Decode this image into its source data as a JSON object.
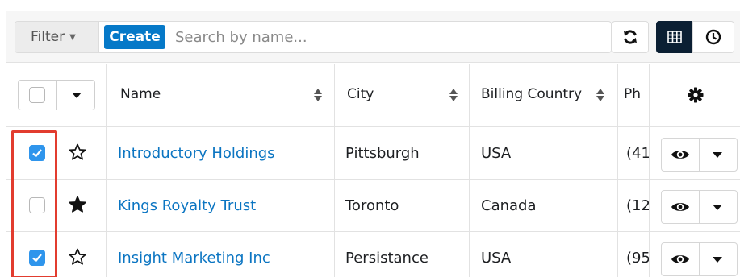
{
  "toolbar": {
    "filter_label": "Filter",
    "create_label": "Create",
    "search_placeholder": "Search by name...",
    "accent_color": "#0679c8",
    "active_view_color": "#0b1f33",
    "icons": [
      "refresh-icon",
      "list-view-icon",
      "activity-stream-icon"
    ]
  },
  "table": {
    "columns": [
      "Name",
      "City",
      "Billing Country",
      "Ph"
    ],
    "rows": [
      {
        "selected": true,
        "favorite": false,
        "name": "Introductory Holdings",
        "city": "Pittsburgh",
        "country": "USA",
        "phone": "(41"
      },
      {
        "selected": false,
        "favorite": true,
        "name": "Kings Royalty Trust",
        "city": "Toronto",
        "country": "Canada",
        "phone": "(12"
      },
      {
        "selected": true,
        "favorite": false,
        "name": "Insight Marketing Inc",
        "city": "Persistance",
        "country": "USA",
        "phone": "(95"
      }
    ],
    "link_color": "#0b75c2",
    "checkbox_checked_color": "#2f95ec",
    "highlight_color": "#e23c2f"
  }
}
